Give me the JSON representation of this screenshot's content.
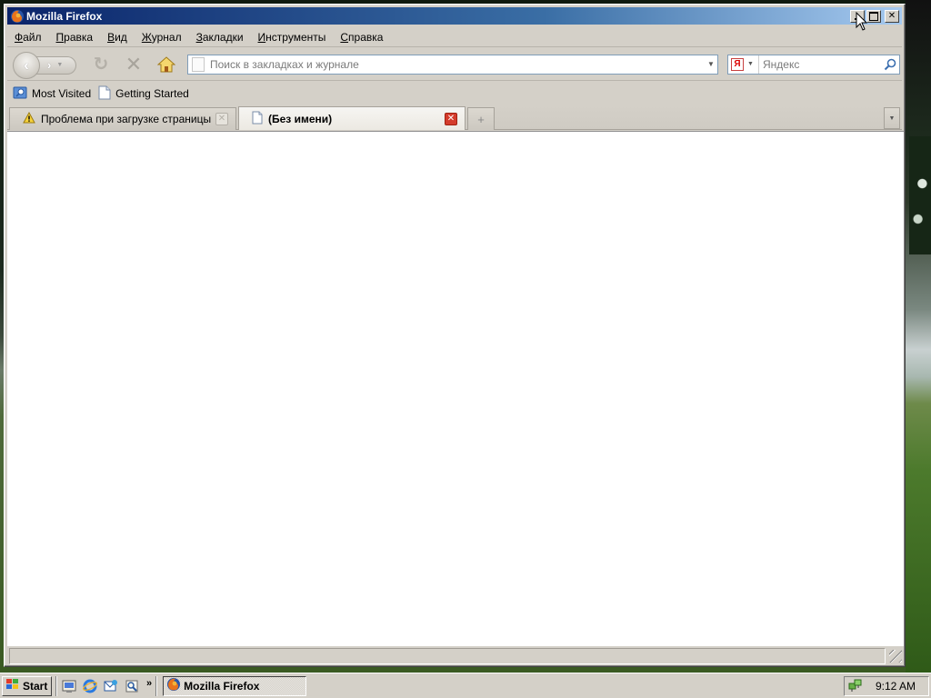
{
  "window": {
    "title": "Mozilla Firefox"
  },
  "menubar": {
    "items": [
      "Файл",
      "Правка",
      "Вид",
      "Журнал",
      "Закладки",
      "Инструменты",
      "Справка"
    ]
  },
  "navbar": {
    "url_placeholder": "Поиск в закладках и журнале",
    "url_value": "",
    "search_engine": "Яндекс",
    "search_placeholder": "Яндекс"
  },
  "bookmarks": {
    "items": [
      "Most Visited",
      "Getting Started"
    ]
  },
  "tabs": [
    {
      "label": "Проблема при загрузке страницы",
      "icon": "warning-icon",
      "selected": false
    },
    {
      "label": "(Без имени)",
      "icon": "blank-page-icon",
      "selected": true
    }
  ],
  "taskbar": {
    "start_label": "Start",
    "task_label": "Mozilla Firefox",
    "clock": "9:12 AM"
  },
  "colors": {
    "titlebar_start": "#0a246a",
    "titlebar_end": "#a6caf0",
    "chrome": "#d4d0c8",
    "active_tab_close": "#d43c2c"
  }
}
